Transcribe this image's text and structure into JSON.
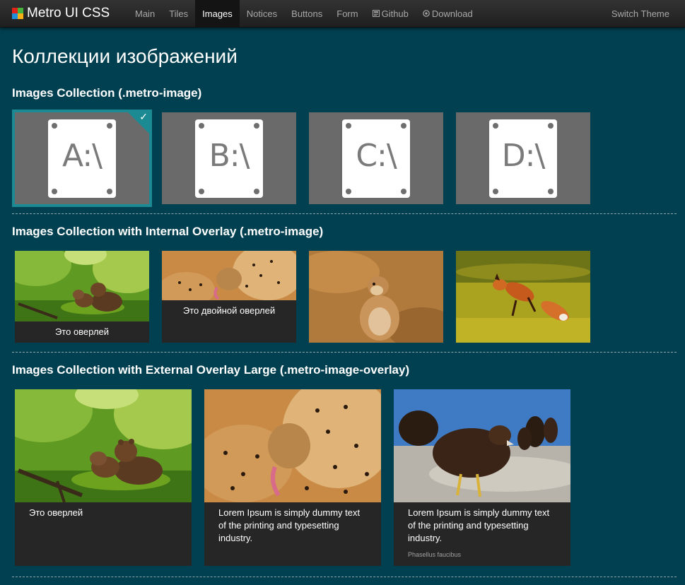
{
  "brand": {
    "name": "Metro UI CSS",
    "logo_colors": [
      "#e2231a",
      "#46b33d",
      "#1e8fd8",
      "#f9b115"
    ]
  },
  "nav": {
    "items": [
      {
        "label": "Main"
      },
      {
        "label": "Tiles"
      },
      {
        "label": "Images",
        "active": true
      },
      {
        "label": "Notices"
      },
      {
        "label": "Buttons"
      },
      {
        "label": "Form"
      },
      {
        "label": "Github",
        "icon": "github-icon"
      },
      {
        "label": "Download",
        "icon": "download-icon"
      }
    ],
    "switch_theme": "Switch Theme"
  },
  "page_title": "Коллекции изображений",
  "sections": {
    "collection": {
      "title": "Images Collection (.metro-image)",
      "drives": [
        "A:\\",
        "B:\\",
        "C:\\",
        "D:\\"
      ],
      "selected_index": 0
    },
    "internal": {
      "title": "Images Collection with Internal Overlay (.metro-image)",
      "items": [
        {
          "image": "bear-cubs-photo",
          "overlay": "Это оверлей"
        },
        {
          "image": "cheetahs-photo",
          "overlay": "Это двойной оверлей"
        },
        {
          "image": "prairie-dog-photo",
          "overlay": ""
        },
        {
          "image": "jumping-fox-photo",
          "overlay": ""
        }
      ]
    },
    "external": {
      "title": "Images Collection with External Overlay Large (.metro-image-overlay)",
      "items": [
        {
          "image": "bear-cubs-photo",
          "text": "Это оверлей",
          "sub": ""
        },
        {
          "image": "cheetahs-photo",
          "text": "Lorem Ipsum is simply dummy text of the printing and typesetting industry.",
          "sub": ""
        },
        {
          "image": "eagles-photo",
          "text": "Lorem Ipsum is simply dummy text of the printing and typesetting industry.",
          "sub": "Phasellus faucibus"
        }
      ]
    }
  },
  "colors": {
    "background": "#004050",
    "accent": "#1b8a92",
    "tile": "#6a6a6a",
    "overlay": "#262626"
  }
}
